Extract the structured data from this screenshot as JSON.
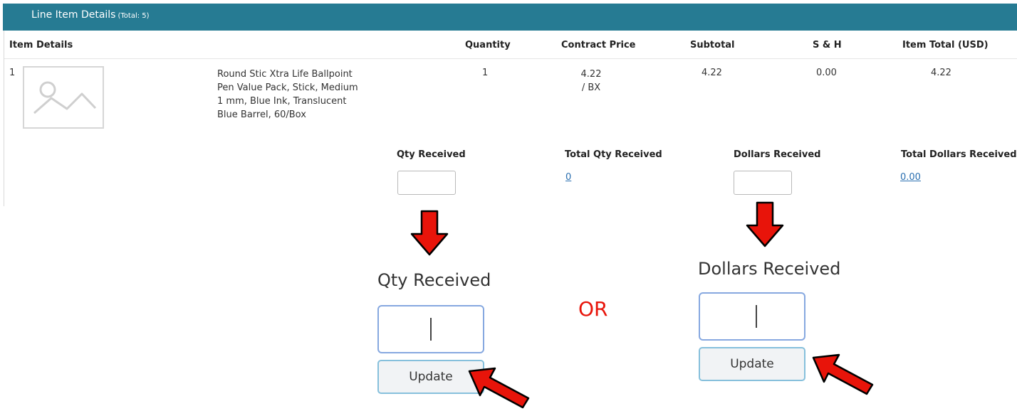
{
  "header": {
    "title": "Line Item Details",
    "count": "(Total: 5)"
  },
  "columns": {
    "item_details": "Item Details",
    "quantity": "Quantity",
    "contract_price": "Contract Price",
    "subtotal": "Subtotal",
    "sh": "S & H",
    "item_total": "Item Total (USD)"
  },
  "row": {
    "number": "1",
    "description_lines": [
      "Round Stic Xtra Life Ballpoint",
      "Pen Value Pack, Stick, Medium",
      "1 mm, Blue Ink, Translucent",
      "Blue Barrel, 60/Box"
    ],
    "quantity": "1",
    "price": "4.22",
    "price_unit": "/ BX",
    "subtotal": "4.22",
    "sh": "0.00",
    "item_total": "4.22"
  },
  "receiving": {
    "qty_received_label": "Qty Received",
    "total_qty_received_label": "Total Qty Received",
    "total_qty_received_value": "0",
    "dollars_received_label": "Dollars Received",
    "total_dollars_received_label": "Total Dollars Received",
    "total_dollars_received_value": "0.00"
  },
  "callout": {
    "qty_label": "Qty Received",
    "dollars_label": "Dollars Received",
    "update_label": "Update",
    "or_text": "OR"
  },
  "colors": {
    "header_bg": "#267b93",
    "arrow_red": "#e8140a",
    "or_red": "#e8140a",
    "link_blue": "#2a6fb0"
  },
  "icons": {
    "thumbnail": "image-placeholder-icon",
    "arrow": "red-arrow-icon"
  }
}
